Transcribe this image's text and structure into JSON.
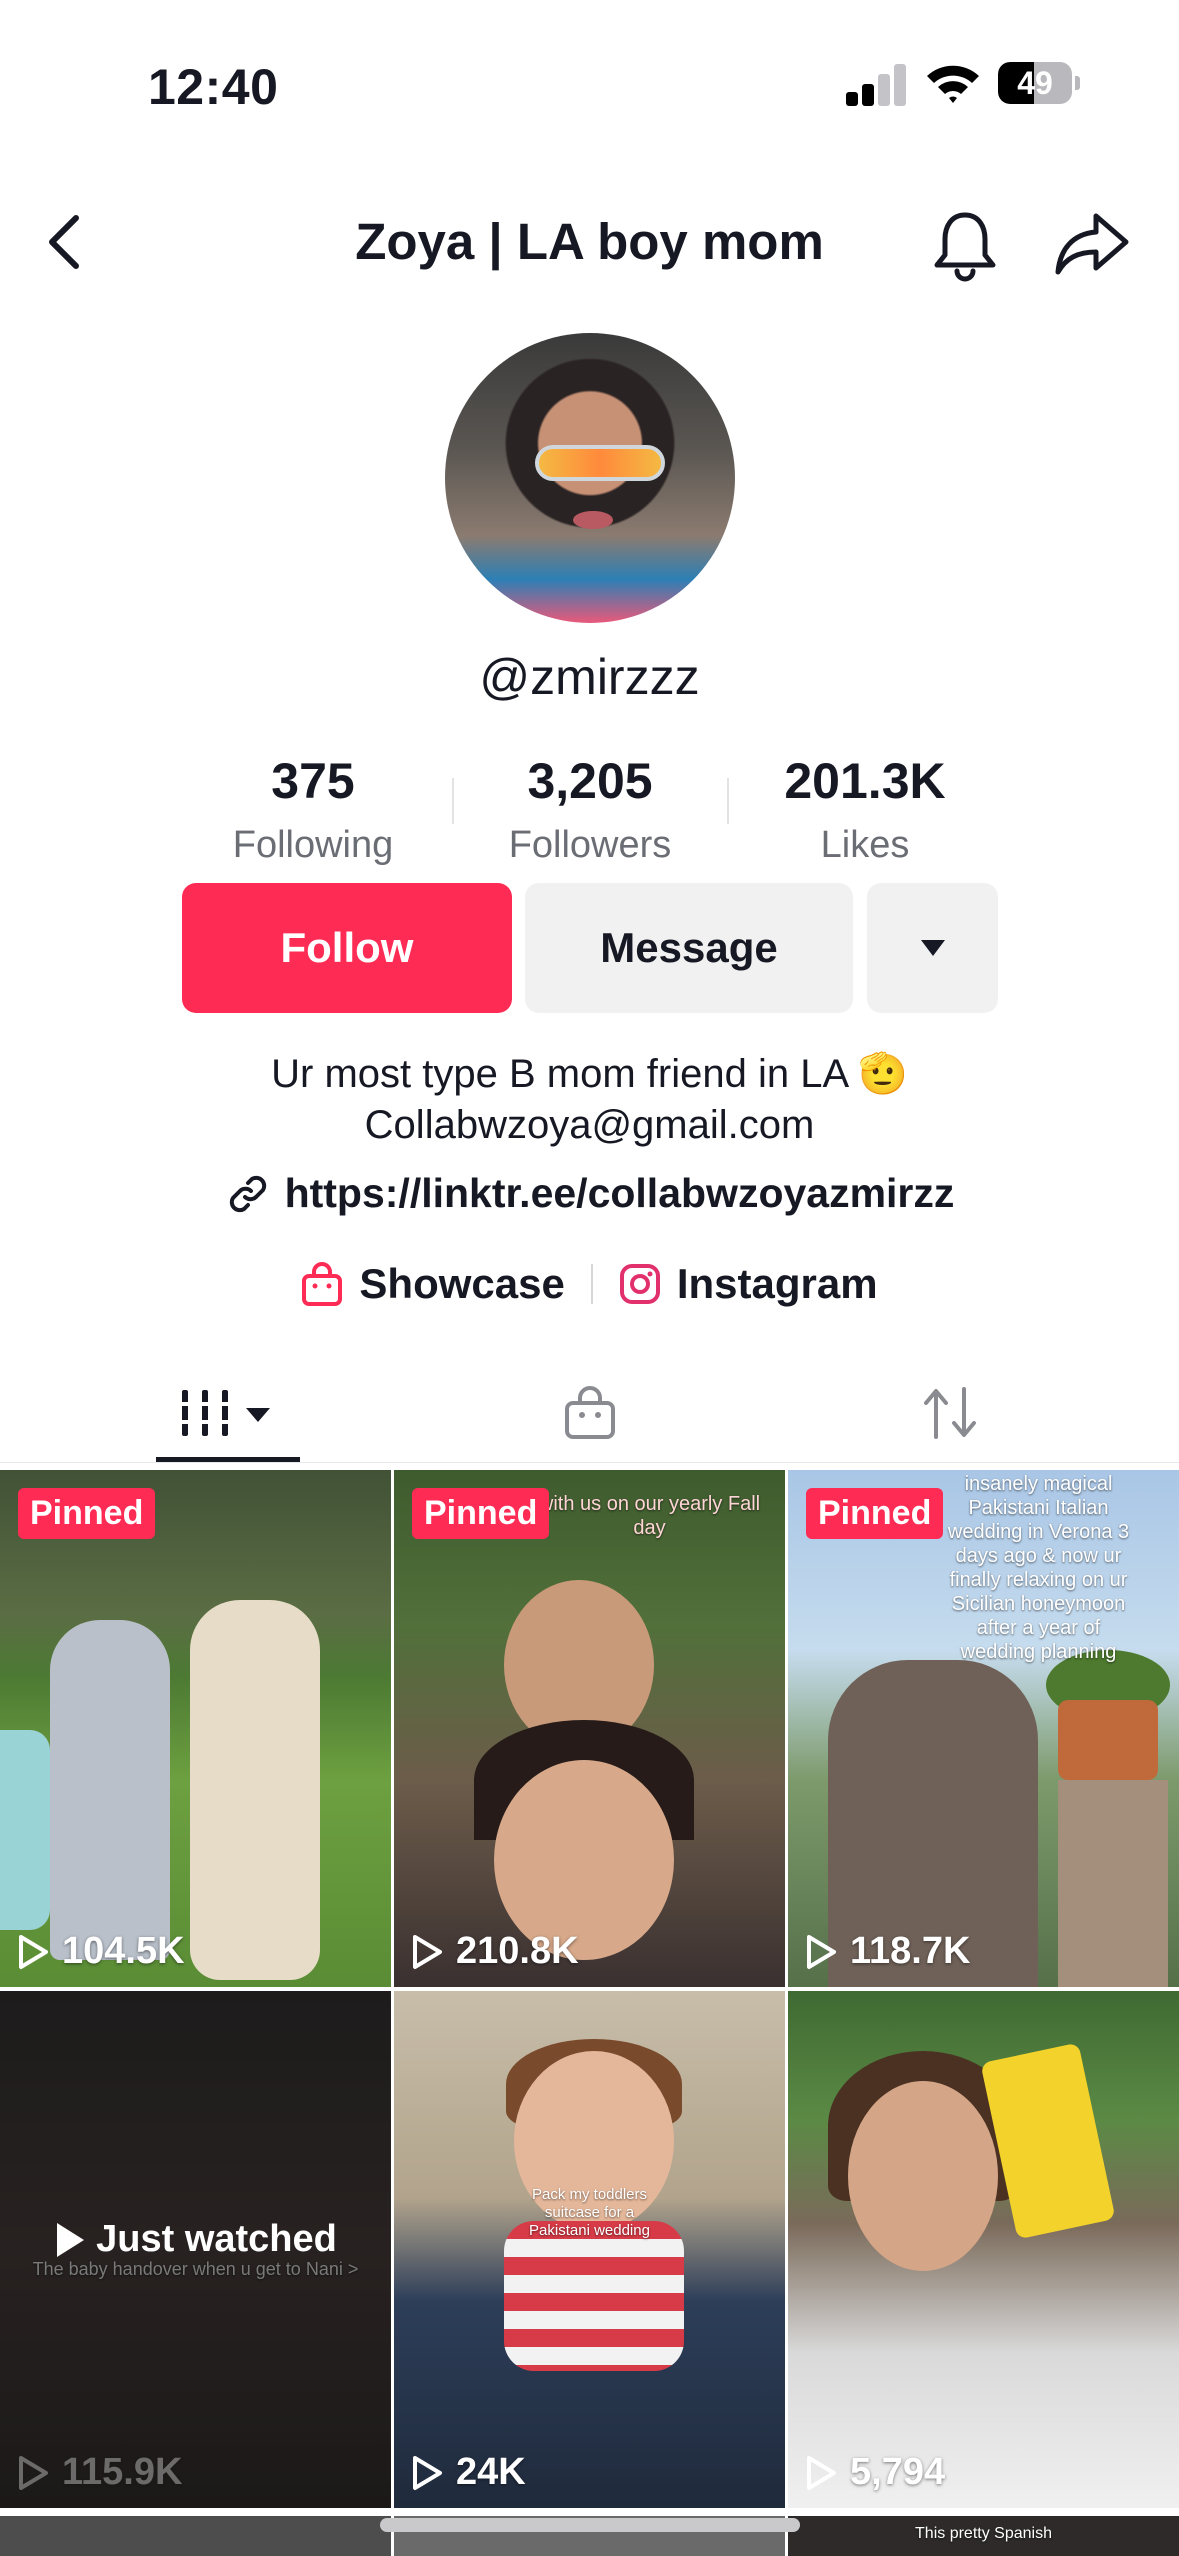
{
  "status_bar": {
    "time": "12:40",
    "battery": "49",
    "battery_level": 0.49
  },
  "header": {
    "title": "Zoya | LA boy mom",
    "back_icon": "chevron-left-icon",
    "notifications_icon": "bell-icon",
    "share_icon": "share-arrow-icon"
  },
  "profile": {
    "handle": "@zmirzzz",
    "stats": [
      {
        "value": "375",
        "label": "Following"
      },
      {
        "value": "3,205",
        "label": "Followers"
      },
      {
        "value": "201.3K",
        "label": "Likes"
      }
    ],
    "buttons": {
      "follow": "Follow",
      "message": "Message",
      "more_icon": "caret-down-icon"
    },
    "bio_line1": "Ur most type B mom friend in LA 🫡",
    "bio_line2": "Collabwzoya@gmail.com",
    "link": "https://linktr.ee/collabwzoyazmirzz",
    "badges": [
      {
        "label": "Showcase",
        "icon": "shopping-bag-icon"
      },
      {
        "label": "Instagram",
        "icon": "instagram-icon"
      }
    ]
  },
  "tabs": [
    {
      "name": "videos",
      "icon": "videos-grid-icon",
      "active": true
    },
    {
      "name": "shop",
      "icon": "shop-bag-icon",
      "active": false
    },
    {
      "name": "reposts",
      "icon": "repost-icon",
      "active": false
    }
  ],
  "videos": [
    {
      "pinned_label": "Pinned",
      "views": "104.5K"
    },
    {
      "pinned_label": "Pinned",
      "views": "210.8K",
      "caption": "with us on our yearly Fall day"
    },
    {
      "pinned_label": "Pinned",
      "views": "118.7K",
      "caption": "insanely magical Pakistani Italian wedding in Verona 3 days ago & now ur finally relaxing on ur Sicilian honeymoon after a year of wedding planning"
    },
    {
      "views": "115.9K",
      "overlay": "Just watched",
      "caption": "The baby handover when u get to Nani >"
    },
    {
      "views": "24K",
      "caption": "Pack my toddlers suitcase for a Pakistani wedding"
    },
    {
      "views": "5,794"
    },
    {},
    {},
    {
      "caption": "This pretty Spanish"
    }
  ],
  "colors": {
    "accent": "#fe2c55",
    "text": "#161823",
    "secondary_text": "#6b6d75",
    "button_gray": "#f1f1f2"
  }
}
